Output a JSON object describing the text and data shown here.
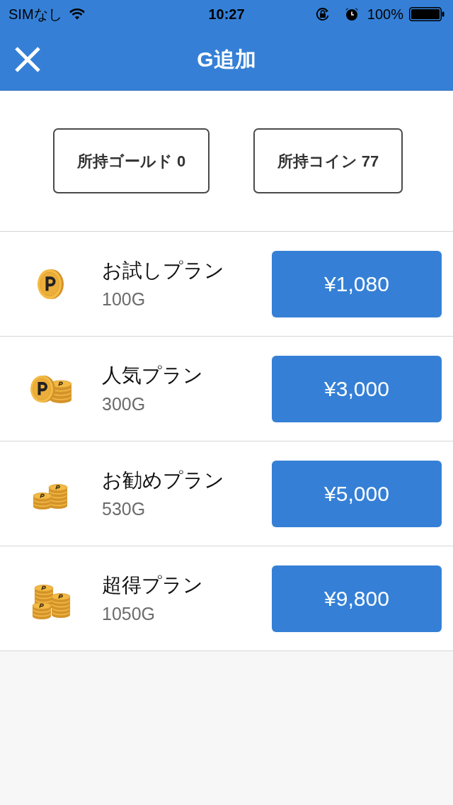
{
  "status_bar": {
    "carrier": "SIMなし",
    "time": "10:27",
    "battery": "100%"
  },
  "nav": {
    "title": "G追加"
  },
  "balances": [
    {
      "label": "所持ゴールド 0"
    },
    {
      "label": "所持コイン 77"
    }
  ],
  "plans": [
    {
      "kind": "single",
      "name": "お試しプラン",
      "amount": "100G",
      "price": "¥1,080"
    },
    {
      "kind": "pair",
      "name": "人気プラン",
      "amount": "300G",
      "price": "¥3,000"
    },
    {
      "kind": "double",
      "name": "お勧めプラン",
      "amount": "530G",
      "price": "¥5,000"
    },
    {
      "kind": "triple",
      "name": "超得プラン",
      "amount": "1050G",
      "price": "¥9,800"
    }
  ]
}
